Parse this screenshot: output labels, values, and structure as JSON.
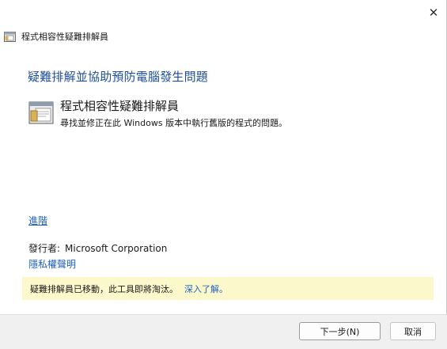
{
  "window": {
    "title": "程式相容性疑難排解員",
    "close_glyph": "✕"
  },
  "main": {
    "heading": "疑難排解並協助預防電腦發生問題",
    "tool": {
      "title": "程式相容性疑難排解員",
      "description": "尋找並修正在此 Windows 版本中執行舊版的程式的問題。",
      "icon": "compatibility-troubleshooter-icon"
    },
    "advanced_link": "進階",
    "publisher_label": "發行者:",
    "publisher_value": "Microsoft Corporation",
    "privacy_link": "隱私權聲明"
  },
  "notice": {
    "text": "疑難排解員已移動，此工具即將淘汰。",
    "learn_more": "深入了解。"
  },
  "footer": {
    "next_label": "下一步(N)",
    "cancel_label": "取消"
  },
  "colors": {
    "heading": "#1f4e9a",
    "link": "#1f5fbf",
    "notice_bg": "#fbf8cc",
    "footer_bg": "#f0f0f0"
  }
}
